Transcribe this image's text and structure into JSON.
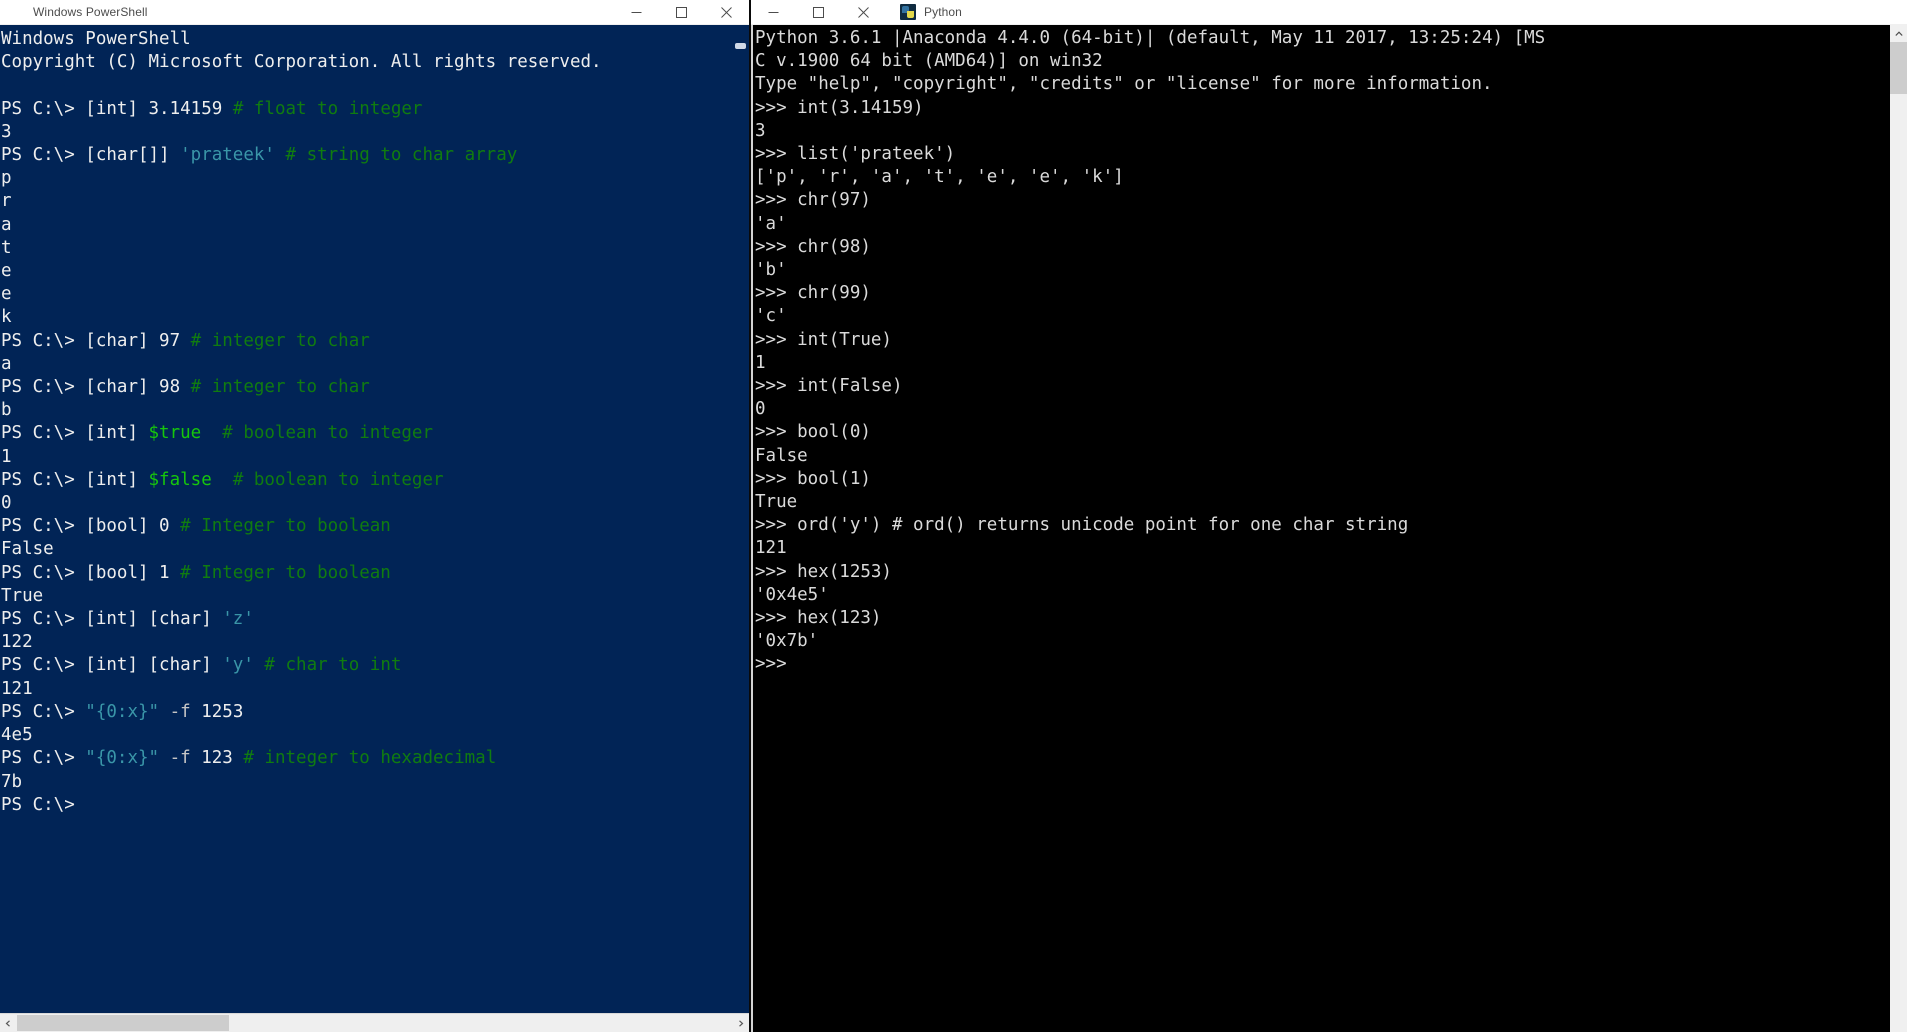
{
  "powershell": {
    "window_title": "Windows PowerShell",
    "icon": "powershell-icon",
    "buttons": {
      "minimize": "minimize-button",
      "maximize": "maximize-button",
      "close": "close-button"
    },
    "header": [
      "Windows PowerShell",
      "Copyright (C) Microsoft Corporation. All rights reserved."
    ],
    "lines": [
      {
        "type": "prompt",
        "prompt": "PS C:\\> ",
        "segments": [
          {
            "text": "[int] 3.14159 ",
            "cls": "tok-default"
          },
          {
            "text": "# float to integer",
            "cls": "tok-comment"
          }
        ]
      },
      {
        "type": "output",
        "text": "3"
      },
      {
        "type": "prompt",
        "prompt": "PS C:\\> ",
        "segments": [
          {
            "text": "[char[]] ",
            "cls": "tok-default"
          },
          {
            "text": "'prateek'",
            "cls": "tok-string"
          },
          {
            "text": " ",
            "cls": "tok-default"
          },
          {
            "text": "# string to char array",
            "cls": "tok-comment"
          }
        ]
      },
      {
        "type": "output",
        "text": "p"
      },
      {
        "type": "output",
        "text": "r"
      },
      {
        "type": "output",
        "text": "a"
      },
      {
        "type": "output",
        "text": "t"
      },
      {
        "type": "output",
        "text": "e"
      },
      {
        "type": "output",
        "text": "e"
      },
      {
        "type": "output",
        "text": "k"
      },
      {
        "type": "prompt",
        "prompt": "PS C:\\> ",
        "segments": [
          {
            "text": "[char] 97 ",
            "cls": "tok-default"
          },
          {
            "text": "# integer to char",
            "cls": "tok-comment"
          }
        ]
      },
      {
        "type": "output",
        "text": "a"
      },
      {
        "type": "prompt",
        "prompt": "PS C:\\> ",
        "segments": [
          {
            "text": "[char] 98 ",
            "cls": "tok-default"
          },
          {
            "text": "# integer to char",
            "cls": "tok-comment"
          }
        ]
      },
      {
        "type": "output",
        "text": "b"
      },
      {
        "type": "prompt",
        "prompt": "PS C:\\> ",
        "segments": [
          {
            "text": "[int] ",
            "cls": "tok-default"
          },
          {
            "text": "$true",
            "cls": "tok-keyword"
          },
          {
            "text": "  ",
            "cls": "tok-default"
          },
          {
            "text": "# boolean to integer",
            "cls": "tok-comment"
          }
        ]
      },
      {
        "type": "output",
        "text": "1"
      },
      {
        "type": "prompt",
        "prompt": "PS C:\\> ",
        "segments": [
          {
            "text": "[int] ",
            "cls": "tok-default"
          },
          {
            "text": "$false",
            "cls": "tok-keyword"
          },
          {
            "text": "  ",
            "cls": "tok-default"
          },
          {
            "text": "# boolean to integer",
            "cls": "tok-comment"
          }
        ]
      },
      {
        "type": "output",
        "text": "0"
      },
      {
        "type": "prompt",
        "prompt": "PS C:\\> ",
        "segments": [
          {
            "text": "[bool] 0 ",
            "cls": "tok-default"
          },
          {
            "text": "# Integer to boolean",
            "cls": "tok-comment"
          }
        ]
      },
      {
        "type": "output",
        "text": "False"
      },
      {
        "type": "prompt",
        "prompt": "PS C:\\> ",
        "segments": [
          {
            "text": "[bool] 1 ",
            "cls": "tok-default"
          },
          {
            "text": "# Integer to boolean",
            "cls": "tok-comment"
          }
        ]
      },
      {
        "type": "output",
        "text": "True"
      },
      {
        "type": "prompt",
        "prompt": "PS C:\\> ",
        "segments": [
          {
            "text": "[int] [char] ",
            "cls": "tok-default"
          },
          {
            "text": "'z'",
            "cls": "tok-string"
          }
        ]
      },
      {
        "type": "output",
        "text": "122"
      },
      {
        "type": "prompt",
        "prompt": "PS C:\\> ",
        "segments": [
          {
            "text": "[int] [char] ",
            "cls": "tok-default"
          },
          {
            "text": "'y'",
            "cls": "tok-string"
          },
          {
            "text": " ",
            "cls": "tok-default"
          },
          {
            "text": "# char to int",
            "cls": "tok-comment"
          }
        ]
      },
      {
        "type": "output",
        "text": "121"
      },
      {
        "type": "prompt",
        "prompt": "PS C:\\> ",
        "segments": [
          {
            "text": "\"{0:x}\"",
            "cls": "tok-string"
          },
          {
            "text": " ",
            "cls": "tok-default"
          },
          {
            "text": "-f",
            "cls": "tok-param"
          },
          {
            "text": " 1253",
            "cls": "tok-default"
          }
        ]
      },
      {
        "type": "output",
        "text": "4e5"
      },
      {
        "type": "prompt",
        "prompt": "PS C:\\> ",
        "segments": [
          {
            "text": "\"{0:x}\"",
            "cls": "tok-string"
          },
          {
            "text": " ",
            "cls": "tok-default"
          },
          {
            "text": "-f",
            "cls": "tok-param"
          },
          {
            "text": " 123 ",
            "cls": "tok-default"
          },
          {
            "text": "# integer to hexadecimal",
            "cls": "tok-comment"
          }
        ]
      },
      {
        "type": "output",
        "text": "7b"
      },
      {
        "type": "prompt",
        "prompt": "PS C:\\> ",
        "segments": []
      }
    ],
    "scrollbars": {
      "vertical": "ps-vertical-scrollbar",
      "horizontal": "ps-horizontal-scrollbar"
    }
  },
  "python": {
    "window_title": "Python",
    "icon": "python-icon",
    "buttons": {
      "minimize": "minimize-button",
      "maximize": "maximize-button",
      "close": "close-button"
    },
    "lines": [
      "Python 3.6.1 |Anaconda 4.4.0 (64-bit)| (default, May 11 2017, 13:25:24) [MS",
      "C v.1900 64 bit (AMD64)] on win32",
      "Type \"help\", \"copyright\", \"credits\" or \"license\" for more information.",
      ">>> int(3.14159)",
      "3",
      ">>> list('prateek')",
      "['p', 'r', 'a', 't', 'e', 'e', 'k']",
      ">>> chr(97)",
      "'a'",
      ">>> chr(98)",
      "'b'",
      ">>> chr(99)",
      "'c'",
      ">>> int(True)",
      "1",
      ">>> int(False)",
      "0",
      ">>> bool(0)",
      "False",
      ">>> bool(1)",
      "True",
      ">>> ord('y') # ord() returns unicode point for one char string",
      "121",
      ">>> hex(1253)",
      "'0x4e5'",
      ">>> hex(123)",
      "'0x7b'",
      ">>> "
    ],
    "scrollbars": {
      "vertical": "py-vertical-scrollbar"
    }
  },
  "colors": {
    "powershell_bg": "#012456",
    "python_bg": "#000000",
    "titlebar_bg": "#ffffff",
    "comment_green": "#107c10",
    "string_teal": "#3a96a8",
    "keyword_green": "#16c60c",
    "text_white": "#eeeeee"
  }
}
